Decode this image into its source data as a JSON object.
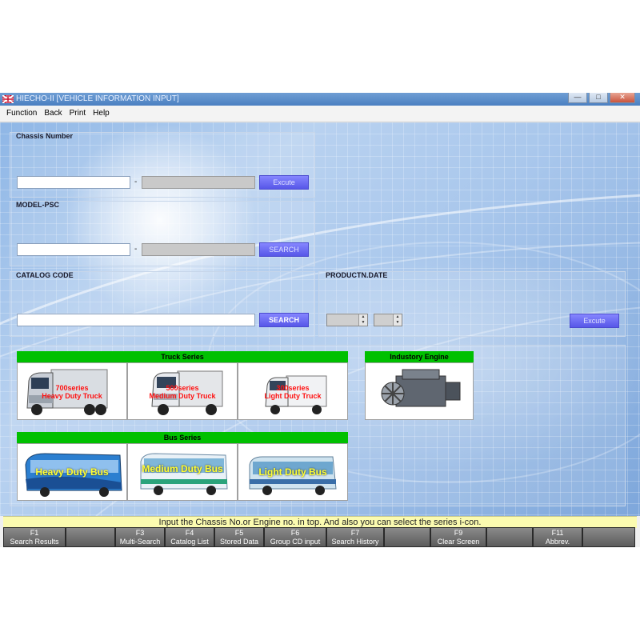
{
  "window": {
    "title": "HIECHO-II [VEHICLE INFORMATION INPUT]",
    "controls": {
      "minimize": "—",
      "maximize": "□",
      "close": "✕"
    }
  },
  "menu": [
    "Function",
    "Back",
    "Print",
    "Help"
  ],
  "chassis": {
    "label": "Chassis Number",
    "value1": "",
    "value2": "",
    "separator": "-",
    "button": "Excute"
  },
  "model": {
    "label": "MODEL-PSC",
    "value1": "",
    "value2": "",
    "separator": "-",
    "button": "SEARCH"
  },
  "catalog": {
    "label": "CATALOG CODE",
    "value": "",
    "button": "SEARCH"
  },
  "production": {
    "label": "PRODUCTN.DATE",
    "year": "",
    "month": "",
    "button": "Excute"
  },
  "truck_series": {
    "header": "Truck Series",
    "items": [
      {
        "line1": "700series",
        "line2": "Heavy Duty Truck"
      },
      {
        "line1": "500series",
        "line2": "Medium Duty Truck"
      },
      {
        "line1": "300series",
        "line2": "Light Duty Truck"
      }
    ]
  },
  "industry": {
    "header": "Industory Engine"
  },
  "bus_series": {
    "header": "Bus Series",
    "items": [
      {
        "label": "Heavy Duty Bus"
      },
      {
        "label": "Medium Duty Bus"
      },
      {
        "label": "Light Duty Bus"
      }
    ]
  },
  "status": "Input the Chassis No.or Engine no. in top. And also you can select the series i-con.",
  "fkeys": [
    {
      "key": "F1",
      "label": "Search Results"
    },
    {
      "key": "",
      "label": ""
    },
    {
      "key": "F3",
      "label": "Multi-Search"
    },
    {
      "key": "F4",
      "label": "Catalog List"
    },
    {
      "key": "F5",
      "label": "Stored Data"
    },
    {
      "key": "F6",
      "label": "Group CD input"
    },
    {
      "key": "F7",
      "label": "Search History"
    },
    {
      "key": "",
      "label": ""
    },
    {
      "key": "F9",
      "label": "Clear Screen"
    },
    {
      "key": "",
      "label": ""
    },
    {
      "key": "F11",
      "label": "Abbrev."
    },
    {
      "key": "",
      "label": ""
    }
  ],
  "colors": {
    "accent": "#5757e8",
    "series_header": "#00c000",
    "status_bg": "#fbfbb0",
    "red_label": "#ff1010",
    "yellow_label": "#ffff33"
  }
}
